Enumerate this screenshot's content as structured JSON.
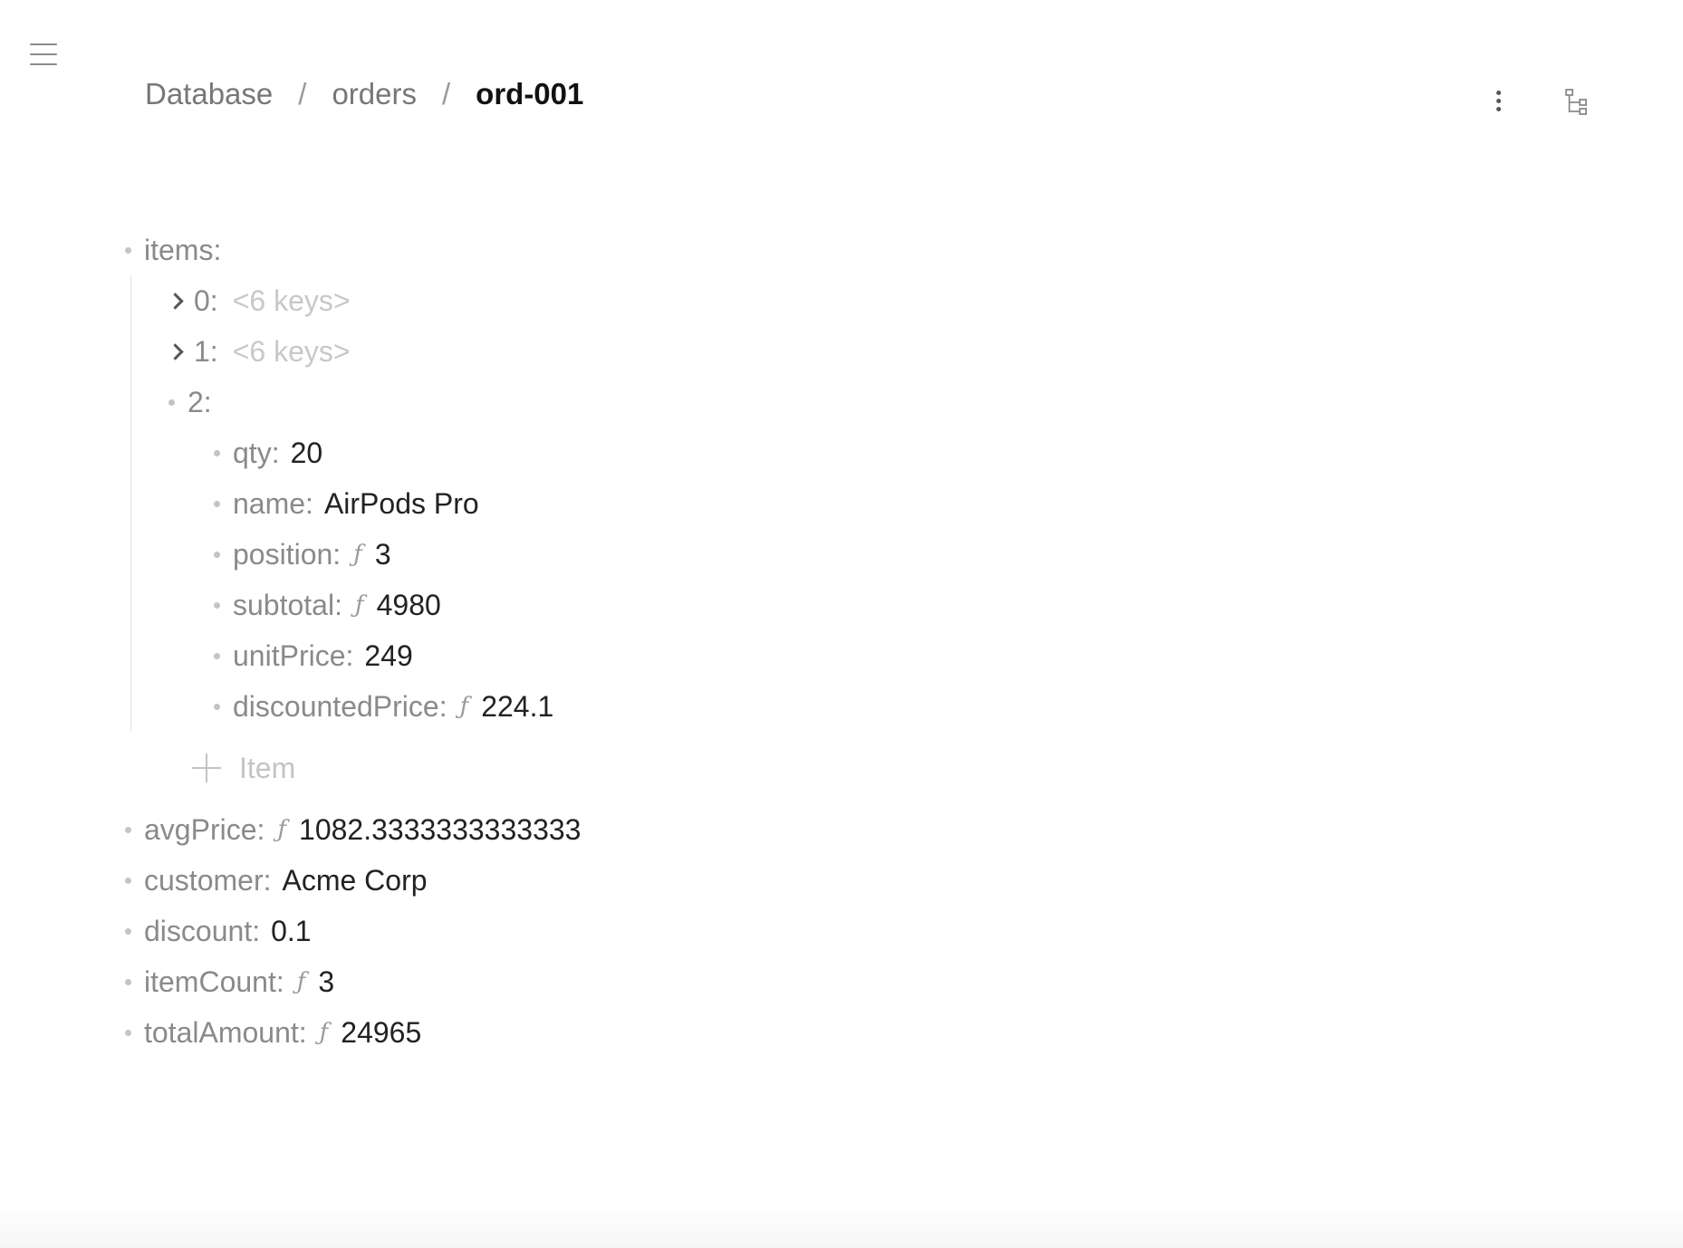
{
  "breadcrumb": {
    "items": [
      "Database",
      "orders",
      "ord-001"
    ],
    "separator": "/"
  },
  "icons": {
    "menu": "hamburger-menu-icon",
    "more": "vertical-ellipsis-icon",
    "tree": "tree-structure-icon",
    "formula": "function-icon",
    "add": "plus-icon"
  },
  "tree": {
    "items_key": "items:",
    "item0": {
      "key": "0:",
      "summary": "<6 keys>"
    },
    "item1": {
      "key": "1:",
      "summary": "<6 keys>"
    },
    "item2": {
      "key": "2:",
      "qty": {
        "key": "qty:",
        "value": "20"
      },
      "name": {
        "key": "name:",
        "value": "AirPods Pro"
      },
      "position": {
        "key": "position:",
        "value": "3"
      },
      "subtotal": {
        "key": "subtotal:",
        "value": "4980"
      },
      "unitPrice": {
        "key": "unitPrice:",
        "value": "249"
      },
      "discountedPrice": {
        "key": "discountedPrice:",
        "value": "224.1"
      }
    },
    "add_item_label": "Item",
    "avgPrice": {
      "key": "avgPrice:",
      "value": "1082.3333333333333"
    },
    "customer": {
      "key": "customer:",
      "value": "Acme Corp"
    },
    "discount": {
      "key": "discount:",
      "value": "0.1"
    },
    "itemCount": {
      "key": "itemCount:",
      "value": "3"
    },
    "totalAmount": {
      "key": "totalAmount:",
      "value": "24965"
    },
    "formula_symbol": "ƒ"
  },
  "colors": {
    "key": "#8a8a8a",
    "value": "#222222",
    "placeholder": "#c8c8c8",
    "bullet": "#c4c4c4"
  }
}
